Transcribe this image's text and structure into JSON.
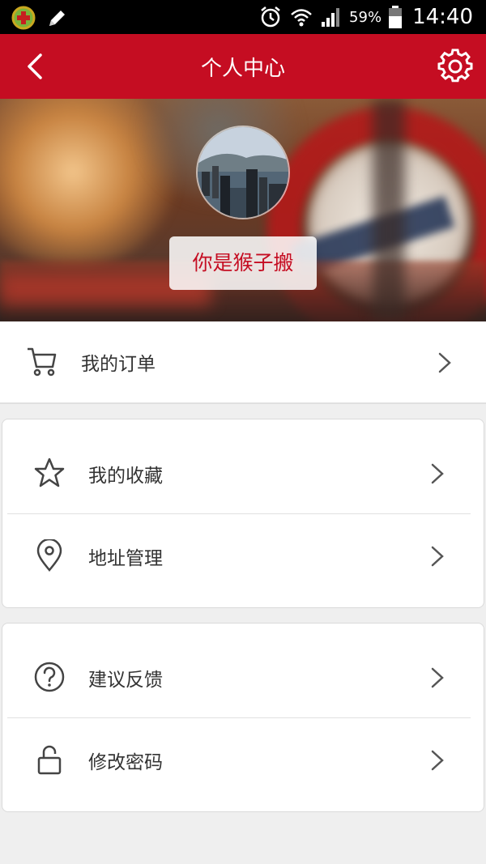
{
  "status_bar": {
    "battery_percent": "59%",
    "time": "14:40"
  },
  "header": {
    "title": "个人中心"
  },
  "profile": {
    "username": "你是猴子搬"
  },
  "menu": {
    "orders": {
      "label": "我的订单",
      "icon": "cart-icon"
    },
    "favorites": {
      "label": "我的收藏",
      "icon": "star-icon"
    },
    "address": {
      "label": "地址管理",
      "icon": "location-pin-icon"
    },
    "feedback": {
      "label": "建议反馈",
      "icon": "question-circle-icon"
    },
    "password": {
      "label": "修改密码",
      "icon": "unlock-icon"
    }
  },
  "colors": {
    "brand_red": "#c50d22",
    "page_background": "#efefef"
  }
}
